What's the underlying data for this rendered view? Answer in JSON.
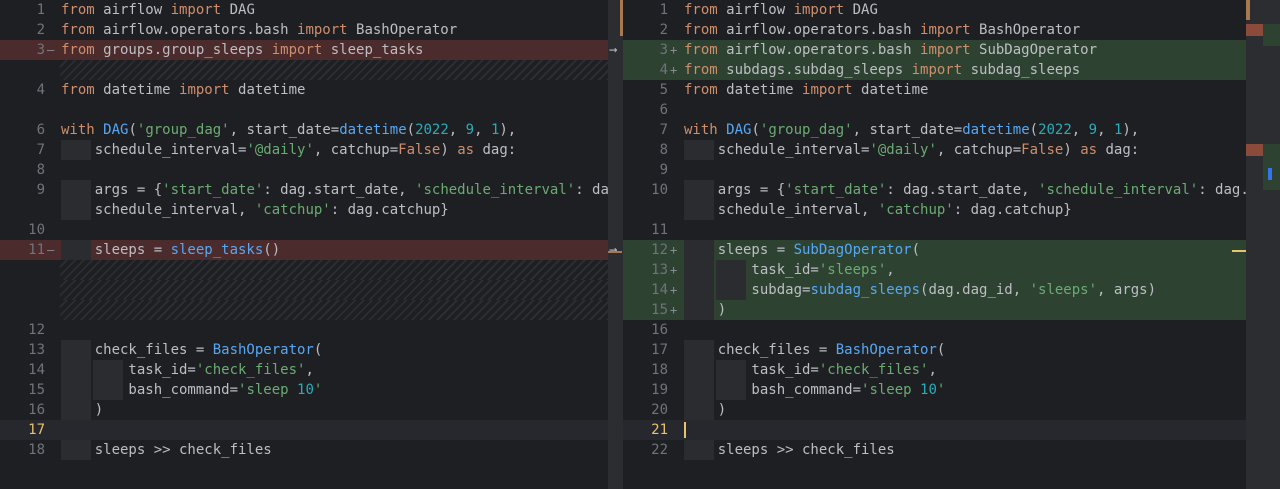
{
  "left": {
    "lines": [
      {
        "num": "1",
        "marker": "",
        "code": "from airflow import DAG"
      },
      {
        "num": "2",
        "marker": "",
        "code": "from airflow.operators.bash import BashOperator"
      },
      {
        "num": "3",
        "marker": "—",
        "code": "from groups.group_sleeps import sleep_tasks"
      },
      {
        "num": "4",
        "marker": "",
        "code": "from datetime import datetime"
      },
      {
        "num": "6",
        "marker": "",
        "code": "with DAG('group_dag', start_date=datetime(2022, 9, 1),"
      },
      {
        "num": "7",
        "marker": "",
        "code": "    schedule_interval='@daily', catchup=False) as dag:"
      },
      {
        "num": "8",
        "marker": "",
        "code": ""
      },
      {
        "num": "9",
        "marker": "",
        "code": "    args = {'start_date': dag.start_date, 'schedule_interval': dag."
      },
      {
        "num": "",
        "marker": "",
        "code": "    schedule_interval, 'catchup': dag.catchup}"
      },
      {
        "num": "10",
        "marker": "",
        "code": ""
      },
      {
        "num": "11",
        "marker": "—",
        "code": "    sleeps = sleep_tasks()"
      },
      {
        "num": "12",
        "marker": "",
        "code": ""
      },
      {
        "num": "13",
        "marker": "",
        "code": "    check_files = BashOperator("
      },
      {
        "num": "14",
        "marker": "",
        "code": "        task_id='check_files',"
      },
      {
        "num": "15",
        "marker": "",
        "code": "        bash_command='sleep 10'"
      },
      {
        "num": "16",
        "marker": "",
        "code": "    )"
      },
      {
        "num": "17",
        "marker": "",
        "code": ""
      },
      {
        "num": "18",
        "marker": "",
        "code": "    sleeps >> check_files"
      }
    ]
  },
  "right": {
    "lines": [
      {
        "num": "1",
        "marker": "",
        "code": "from airflow import DAG"
      },
      {
        "num": "2",
        "marker": "",
        "code": "from airflow.operators.bash import BashOperator"
      },
      {
        "num": "3",
        "marker": "+",
        "code": "from airflow.operators.bash import SubDagOperator"
      },
      {
        "num": "4",
        "marker": "+",
        "code": "from subdags.subdag_sleeps import subdag_sleeps"
      },
      {
        "num": "5",
        "marker": "",
        "code": "from datetime import datetime"
      },
      {
        "num": "6",
        "marker": "",
        "code": ""
      },
      {
        "num": "7",
        "marker": "",
        "code": "with DAG('group_dag', start_date=datetime(2022, 9, 1),"
      },
      {
        "num": "8",
        "marker": "",
        "code": "    schedule_interval='@daily', catchup=False) as dag:"
      },
      {
        "num": "9",
        "marker": "",
        "code": ""
      },
      {
        "num": "10",
        "marker": "",
        "code": "    args = {'start_date': dag.start_date, 'schedule_interval': dag."
      },
      {
        "num": "",
        "marker": "",
        "code": "    schedule_interval, 'catchup': dag.catchup}"
      },
      {
        "num": "11",
        "marker": "",
        "code": ""
      },
      {
        "num": "12",
        "marker": "+",
        "code": "    sleeps = SubDagOperator("
      },
      {
        "num": "13",
        "marker": "+",
        "code": "        task_id='sleeps',"
      },
      {
        "num": "14",
        "marker": "+",
        "code": "        subdag=subdag_sleeps(dag.dag_id, 'sleeps', args)"
      },
      {
        "num": "15",
        "marker": "+",
        "code": "    )"
      },
      {
        "num": "16",
        "marker": "",
        "code": ""
      },
      {
        "num": "17",
        "marker": "",
        "code": "    check_files = BashOperator("
      },
      {
        "num": "18",
        "marker": "",
        "code": "        task_id='check_files',"
      },
      {
        "num": "19",
        "marker": "",
        "code": "        bash_command='sleep 10'"
      },
      {
        "num": "20",
        "marker": "",
        "code": "    )"
      },
      {
        "num": "21",
        "marker": "",
        "code": ""
      },
      {
        "num": "22",
        "marker": "",
        "code": "    sleeps >> check_files"
      }
    ]
  },
  "colors": {
    "deleted": "#4b2b2c",
    "added": "#2d4230",
    "keyword": "#cf8e6d",
    "string": "#6aab73",
    "function": "#56a8f5",
    "current_line_number": "#e8c36a"
  },
  "icons": {
    "apply_change": "arrow-right-icon"
  }
}
